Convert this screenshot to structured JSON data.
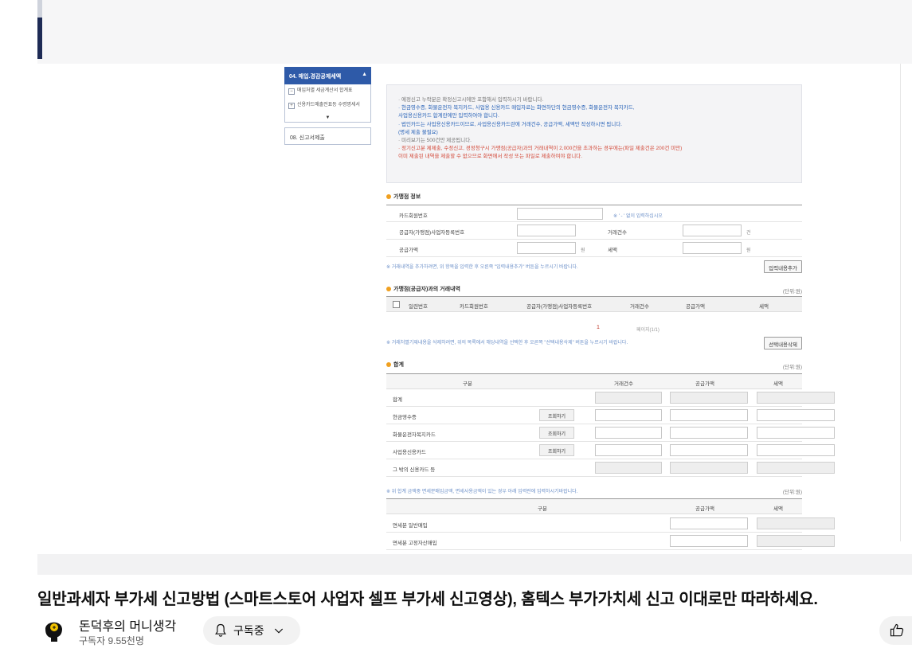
{
  "video": {
    "title": "일반과세자 부가세 신고방법 (스마트스토어 사업자 셀프 부가세 신고영상), 홈텍스 부가가치세 신고 이대로만 따라하세요.",
    "channel_name": "돈덕후의 머니생각",
    "subscribers": "구독자 9.55천명",
    "subscribe_label": "구독중"
  },
  "menu": {
    "header": "04. 매입.경감공제세액",
    "items": [
      "매입처별 세금계산서 합계표",
      "신용카드매출전표등 수령명세서"
    ],
    "item2": "08. 신고서제출"
  },
  "content": {
    "notice_lines": [
      {
        "text": "· 예정신고 누락분은 확정신고시에만 포함해서 입력하시기 바랍니다.",
        "cls": "gray"
      },
      {
        "text": "· 현금영수증, 화물운전자 복지카드, 사업용 신용카드 매입자료는 화면하단의 현금영수증, 화물운전자 복지카드,",
        "cls": "blue"
      },
      {
        "text": "  사업용신용카드 합계란에만 입력하여야 합니다.",
        "cls": "blue"
      },
      {
        "text": "· 법인카드는 사업용신용카드이므로, 사업용신용카드란에 거래건수, 공급가액, 세액만 작성하시면 됩니다.",
        "cls": "blue"
      },
      {
        "text": "  (명세 제출 불필요)",
        "cls": "blue"
      },
      {
        "text": "· 미리보기는 500건만 제공됩니다.",
        "cls": "gray"
      },
      {
        "text": "· 정기신고분 제제출, 수정신고, 경정청구시 가맹점(공급자)과의 거래내역이 2,000건을 초과하는 경우에는(파일 제출건은 200건 미만)",
        "cls": "red"
      },
      {
        "text": "  이미 제출된 내역을 제출할 수 없으므로 화면에서 작성 또는 파일로 제출하여야 합니다.",
        "cls": "red"
      }
    ],
    "merchant": {
      "title": "가맹점 정보",
      "card_no_label": "카드회원번호",
      "card_no_hint": "※ ' - ' 없이 입력하십시오",
      "biz_no_label": "공급자(가맹점)사업자등록번호",
      "count_label": "거래건수",
      "count_suffix": "건",
      "supply_label": "공급가액",
      "supply_suffix": "원",
      "tax_label": "세액",
      "tax_suffix": "원",
      "hint": "※ 거래내역을 추가하려면, 위 항목을 입력한 후 오른쪽 \"입력내용추가\" 버튼을 누르시기 바랍니다.",
      "add_button": "입력내용추가"
    },
    "trades": {
      "title": "가맹점(공급자)과의 거래내역",
      "unit": "(단위:원)",
      "columns": [
        "일련번호",
        "카드회원번호",
        "공급자(가맹점)사업자등록번호",
        "거래건수",
        "공급가액",
        "세액"
      ],
      "page_num": "1",
      "page_info": "페이지(1/1)",
      "hint": "※ 거래처별기재내용을 삭제하려면, 위의 목록에서 해당내역을 선택한 후 오른쪽 \"선택내용삭제\" 버튼을 누르시기 바랍니다.",
      "delete_button": "선택내용삭제"
    },
    "summary": {
      "title": "합계",
      "unit": "(단위:원)",
      "columns": [
        "구분",
        "거래건수",
        "공급가액",
        "세액"
      ],
      "rows": [
        {
          "label": "합계",
          "button": ""
        },
        {
          "label": "현금영수증",
          "button": "조회하기"
        },
        {
          "label": "화물운전자복지카드",
          "button": "조회하기"
        },
        {
          "label": "사업용신용카드",
          "button": "조회하기"
        },
        {
          "label": "그 밖의 신용카드 등",
          "button": ""
        }
      ]
    },
    "exempt": {
      "hint": "※ 위 합계 금액중 면세분매입금액, 면세사용금액이 있는 경우 아래 입력란에 입력하시기바랍니다.",
      "unit": "(단위:원)",
      "columns": [
        "구분",
        "공급가액",
        "세액"
      ],
      "rows": [
        "면세분 일반매입",
        "면세분 고정자산매입"
      ]
    }
  },
  "colors": {
    "menu_header": "#2e5aa8",
    "notice_blue": "#2a64b8",
    "notice_red": "#d34a3a",
    "section_dot": "#f0a020"
  },
  "icons": [
    "bell-icon",
    "chevron-down-icon",
    "thumbs-up-icon",
    "avatar-icon"
  ]
}
